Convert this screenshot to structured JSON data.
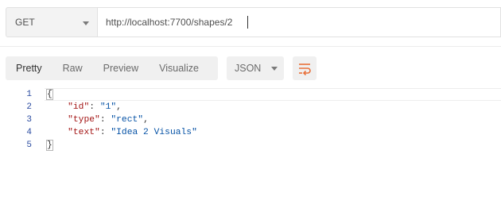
{
  "request": {
    "method": "GET",
    "url": "http://localhost:7700/shapes/2"
  },
  "view_toolbar": {
    "tabs": [
      "Pretty",
      "Raw",
      "Preview",
      "Visualize"
    ],
    "active_tab": "Pretty",
    "format": "JSON",
    "wrap_icon": "wrap-lines-icon",
    "wrap_color": "#e8703a"
  },
  "response_body": {
    "line_numbers": [
      "1",
      "2",
      "3",
      "4",
      "5"
    ],
    "open_brace": "{",
    "close_brace": "}",
    "fields": [
      {
        "key": "\"id\"",
        "value": "\"1\"",
        "trail": ","
      },
      {
        "key": "\"type\"",
        "value": "\"rect\"",
        "trail": ","
      },
      {
        "key": "\"text\"",
        "value": "\"Idea 2 Visuals\"",
        "trail": ""
      }
    ]
  }
}
